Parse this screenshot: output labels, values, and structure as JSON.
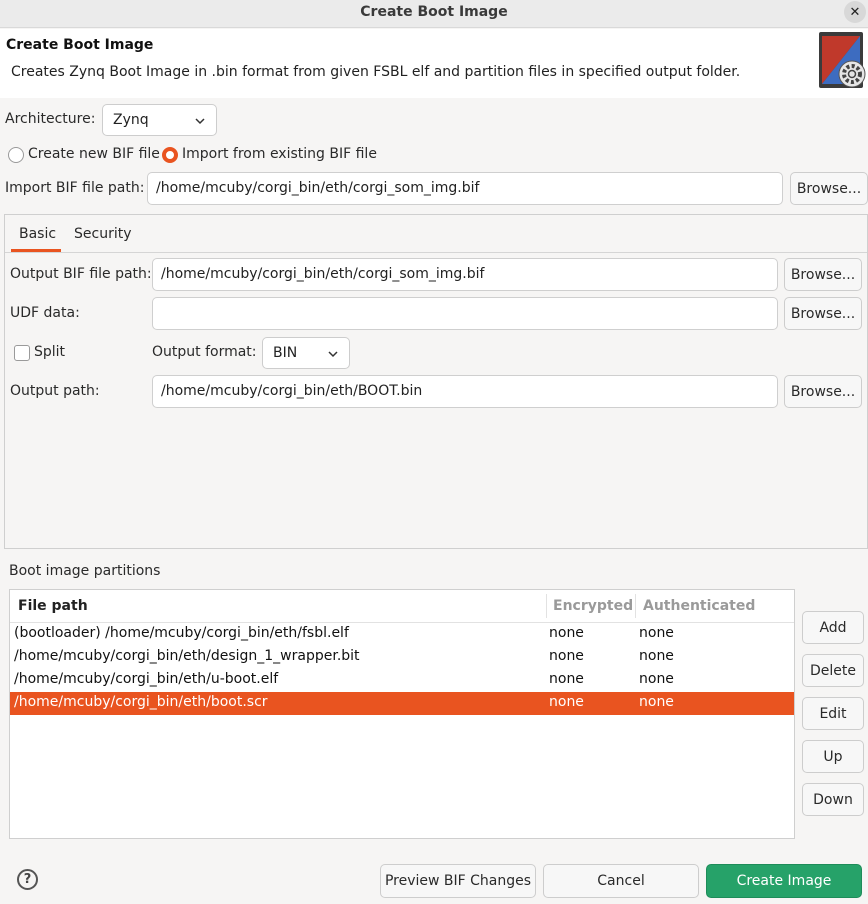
{
  "window": {
    "title": "Create Boot Image",
    "close_glyph": "✕"
  },
  "header": {
    "title": "Create Boot Image",
    "description": "Creates Zynq Boot Image in .bin format from given FSBL elf and partition files in specified output folder.",
    "icon": "boot-image-gear-icon"
  },
  "architecture": {
    "label": "Architecture:",
    "value": "Zynq"
  },
  "bif_mode": {
    "create_label": "Create new BIF file",
    "import_label": "Import from existing BIF file",
    "selected": "import"
  },
  "import_bif": {
    "label": "Import BIF file path:",
    "value": "/home/mcuby/corgi_bin/eth/corgi_som_img.bif",
    "browse": "Browse..."
  },
  "tabs": [
    {
      "label": "Basic",
      "active": true
    },
    {
      "label": "Security",
      "active": false
    }
  ],
  "basic": {
    "output_bif": {
      "label": "Output BIF file path:",
      "value": "/home/mcuby/corgi_bin/eth/corgi_som_img.bif",
      "browse": "Browse..."
    },
    "udf": {
      "label": "UDF data:",
      "value": "",
      "browse": "Browse..."
    },
    "split": {
      "label": "Split",
      "checked": false
    },
    "output_format": {
      "label": "Output format:",
      "value": "BIN"
    },
    "output_path": {
      "label": "Output path:",
      "value": "/home/mcuby/corgi_bin/eth/BOOT.bin",
      "browse": "Browse..."
    }
  },
  "partitions": {
    "label": "Boot image partitions",
    "columns": [
      "File path",
      "Encrypted",
      "Authenticated"
    ],
    "rows": [
      {
        "path": "(bootloader) /home/mcuby/corgi_bin/eth/fsbl.elf",
        "encrypted": "none",
        "authenticated": "none"
      },
      {
        "path": "/home/mcuby/corgi_bin/eth/design_1_wrapper.bit",
        "encrypted": "none",
        "authenticated": "none"
      },
      {
        "path": "/home/mcuby/corgi_bin/eth/u-boot.elf",
        "encrypted": "none",
        "authenticated": "none"
      },
      {
        "path": "/home/mcuby/corgi_bin/eth/boot.scr",
        "encrypted": "none",
        "authenticated": "none",
        "selected": true
      }
    ],
    "buttons": {
      "add": "Add",
      "delete": "Delete",
      "edit": "Edit",
      "up": "Up",
      "down": "Down"
    }
  },
  "footer": {
    "help": "?",
    "preview": "Preview BIF Changes",
    "cancel": "Cancel",
    "create": "Create Image"
  },
  "colors": {
    "accent": "#e95420",
    "primary_button": "#26a269"
  }
}
